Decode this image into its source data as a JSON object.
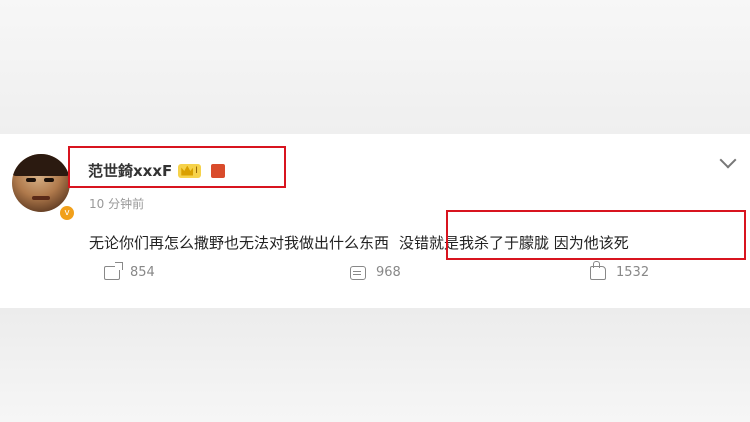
{
  "comment": {
    "username": "范世錡xxxF",
    "level_badge": "I",
    "time": "10 分钟前",
    "text_main": "无论你们再怎么撒野也无法对我做出什么东西",
    "text_highlight": "没错就是我杀了于朦胧 因为他该死"
  },
  "actions": {
    "share_count": "854",
    "comment_count": "968",
    "like_count": "1532"
  },
  "colors": {
    "highlight_box": "#d8141f",
    "text_secondary": "#888888",
    "verified_badge": "#f1a01b"
  },
  "icons": [
    "share-icon",
    "comment-icon",
    "like-icon",
    "chevron-down-icon",
    "crown-icon",
    "medal-icon",
    "verified-icon"
  ]
}
